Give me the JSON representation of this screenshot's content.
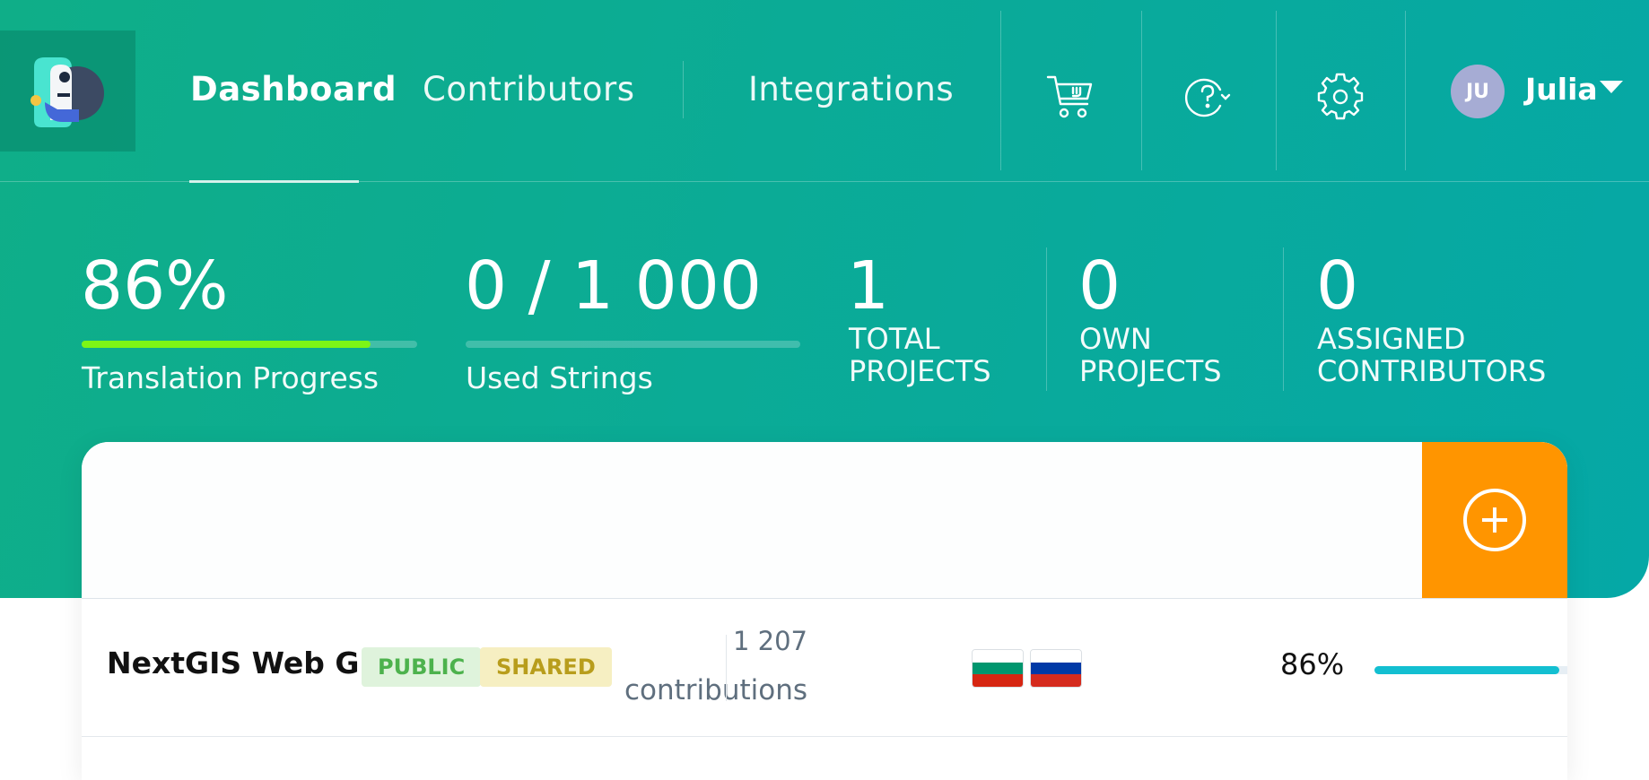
{
  "nav": {
    "links": [
      "Dashboard",
      "Contributors",
      "Integrations"
    ],
    "icons": [
      "cart-icon",
      "help-icon",
      "gear-icon"
    ],
    "user": {
      "initials": "JU",
      "name": "Julia"
    }
  },
  "stats": {
    "progress": {
      "value": "86%",
      "label": "Translation Progress",
      "fraction": 0.86
    },
    "strings": {
      "value": "0 / 1 000",
      "label": "Used Strings",
      "fraction": 0
    },
    "total_projects": {
      "value": "1",
      "line1": "TOTAL",
      "line2": "PROJECTS"
    },
    "own_projects": {
      "value": "0",
      "line1": "OWN",
      "line2": "PROJECTS"
    },
    "assigned": {
      "value": "0",
      "line1": "ASSIGNED",
      "line2": "CONTRIBUTORS"
    }
  },
  "colors": {
    "accent": "#ff9500",
    "progress": "#7df516",
    "row_bar": "#13bfd1"
  },
  "projects": [
    {
      "name": "NextGIS Web GUI",
      "tags": [
        "PUBLIC",
        "SHARED"
      ],
      "contributions_count": "1 207",
      "contributions_label": "contributions",
      "languages": [
        "bulgarian-flag",
        "russian-flag"
      ],
      "progress_text": "86%",
      "progress_fraction": 0.86
    }
  ]
}
